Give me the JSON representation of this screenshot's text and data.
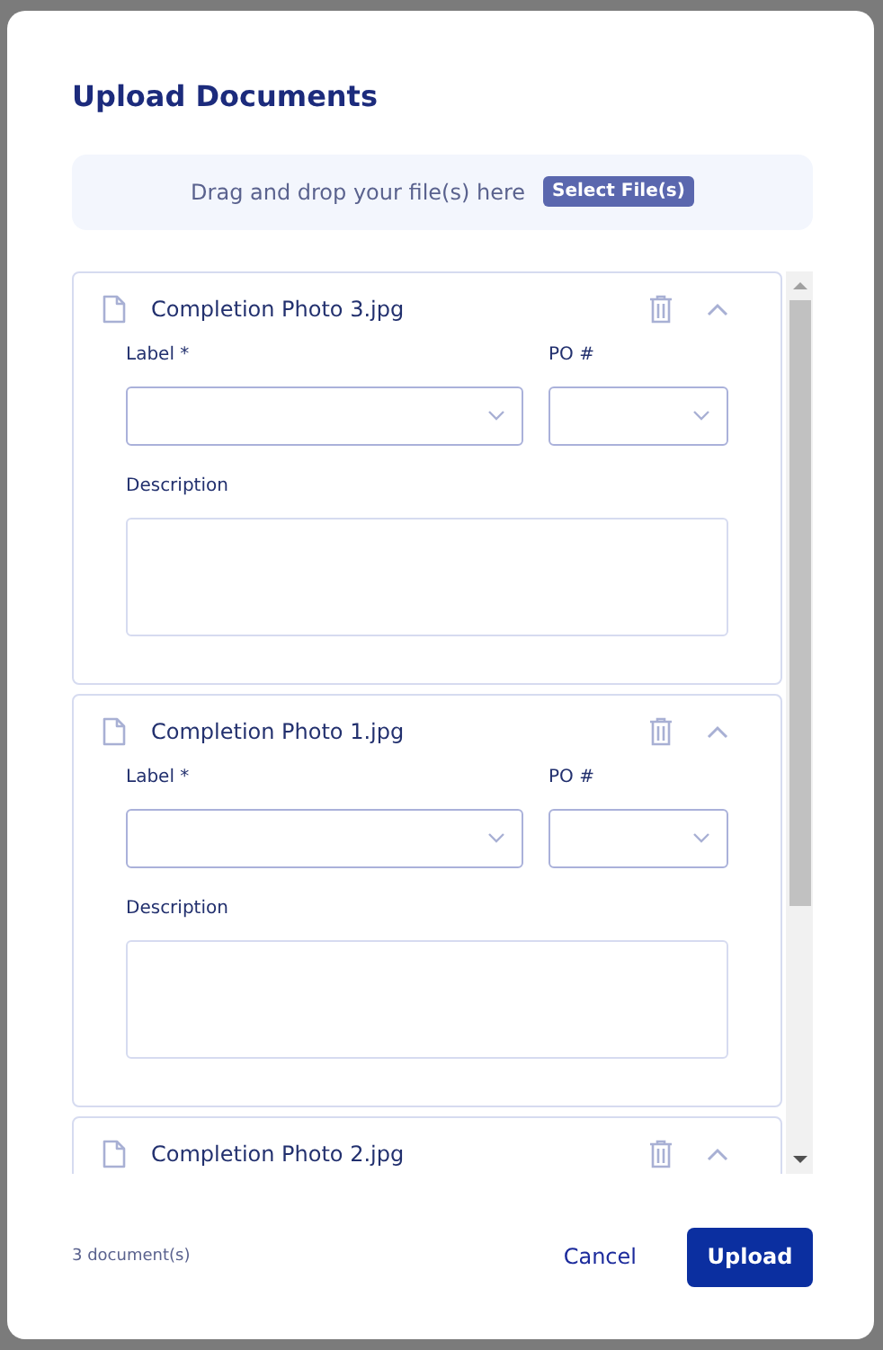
{
  "dialog": {
    "title": "Upload Documents"
  },
  "dropzone": {
    "hint": "Drag and drop your file(s) here",
    "button": "Select File(s)"
  },
  "documents": [
    {
      "file_name": "Completion Photo 3.jpg",
      "expanded": true,
      "fields": [
        {
          "kind": "select",
          "label": "Label *",
          "wide": true
        },
        {
          "kind": "select",
          "label": "PO #",
          "wide": false
        },
        {
          "kind": "textarea",
          "label": "Description",
          "wide": true
        }
      ]
    },
    {
      "file_name": "Completion Photo 1.jpg",
      "expanded": true,
      "fields": [
        {
          "kind": "select",
          "label": "Label *",
          "wide": true
        },
        {
          "kind": "select",
          "label": "PO #",
          "wide": false
        },
        {
          "kind": "textarea",
          "label": "Description",
          "wide": true
        }
      ]
    },
    {
      "file_name": "Completion Photo 2.jpg",
      "expanded": true
    }
  ],
  "footer": {
    "count": "3 document(s)",
    "cancel": "Cancel",
    "upload": "Upload"
  }
}
